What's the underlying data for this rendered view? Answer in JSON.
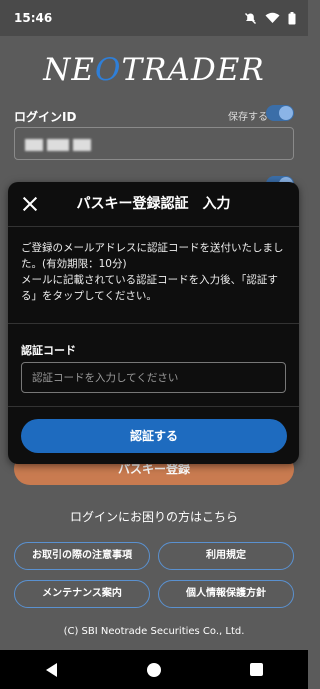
{
  "status_bar": {
    "time": "15:46",
    "icons": [
      "mute-icon",
      "wifi-icon",
      "battery-icon"
    ]
  },
  "logo": {
    "text_before": "NE",
    "text_o": "O",
    "text_after": "TRADER"
  },
  "login": {
    "label": "ログインID",
    "save_label": "保存する",
    "field_value": "**:**"
  },
  "passkey_button": {
    "label": "パスキー登録"
  },
  "trouble_link": "ログインにお困りの方はこちら",
  "links": {
    "cautions": "お取引の際の注意事項",
    "terms": "利用規定",
    "maintenance": "メンテナンス案内",
    "privacy": "個人情報保護方針"
  },
  "copyright": "(C) SBI Neotrade Securities Co., Ltd.",
  "modal": {
    "title": "パスキー登録認証　入力",
    "description_1": "ご登録のメールアドレスに認証コードを送付いたしました。(有効期限：10分)",
    "description_2": "メールに記載されている認証コードを入力後、「認証する」をタップしてください。",
    "code_label": "認証コード",
    "code_placeholder": "認証コードを入力してください",
    "code_value": "",
    "submit_label": "認証する"
  },
  "colors": {
    "accent": "#1e6bbf",
    "passkey": "#c97b50",
    "background": "#5b5b5b",
    "modal": "#0e0e0e"
  }
}
